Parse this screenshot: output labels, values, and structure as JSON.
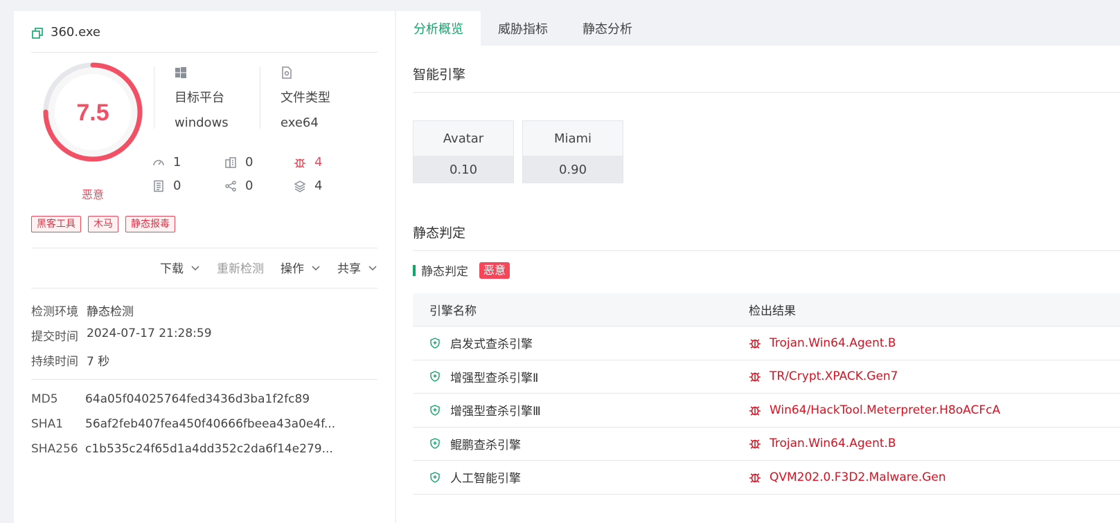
{
  "file": {
    "name": "360.exe"
  },
  "score": {
    "value": "7.5",
    "verdict": "恶意",
    "fraction": 0.75
  },
  "platform": {
    "label": "目标平台",
    "value": "windows"
  },
  "filetype": {
    "label": "文件类型",
    "value": "exe64"
  },
  "stats": [
    {
      "icon": "speedometer-icon",
      "value": "1"
    },
    {
      "icon": "building-icon",
      "value": "0"
    },
    {
      "icon": "bug-icon",
      "value": "4"
    },
    {
      "icon": "document-list-icon",
      "value": "0"
    },
    {
      "icon": "network-share-icon",
      "value": "0"
    },
    {
      "icon": "layers-icon",
      "value": "4"
    }
  ],
  "tags": [
    "黑客工具",
    "木马",
    "静态报毒"
  ],
  "actions": {
    "download": "下载",
    "recheck": "重新检测",
    "operate": "操作",
    "share": "共享"
  },
  "meta": [
    {
      "k": "检测环境",
      "v": "静态检测"
    },
    {
      "k": "提交时间",
      "v": "2024-07-17 21:28:59"
    },
    {
      "k": "持续时间",
      "v": "7 秒"
    }
  ],
  "hashes": [
    {
      "k": "MD5",
      "v": "64a05f04025764fed3436d3ba1f2fc89"
    },
    {
      "k": "SHA1",
      "v": "56af2feb407fea450f40666fbeea43a0e4f..."
    },
    {
      "k": "SHA256",
      "v": "c1b535c24f65d1a4dd352c2da6f14e279..."
    }
  ],
  "tabs": [
    "分析概览",
    "威胁指标",
    "静态分析"
  ],
  "smart_engine": {
    "title": "智能引擎",
    "engines": [
      {
        "name": "Avatar",
        "score": "0.10"
      },
      {
        "name": "Miami",
        "score": "0.90"
      }
    ]
  },
  "static_verdict": {
    "title": "静态判定",
    "sub_label": "静态判定",
    "badge": "恶意",
    "col_engine": "引擎名称",
    "col_result": "检出结果",
    "rows": [
      {
        "engine": "启发式查杀引擎",
        "result": "Trojan.Win64.Agent.B"
      },
      {
        "engine": "增强型查杀引擎Ⅱ",
        "result": "TR/Crypt.XPACK.Gen7"
      },
      {
        "engine": "增强型查杀引擎Ⅲ",
        "result": "Win64/HackTool.Meterpreter.H8oACFcA"
      },
      {
        "engine": "鲲鹏查杀引擎",
        "result": "Trojan.Win64.Agent.B"
      },
      {
        "engine": "人工智能引擎",
        "result": "QVM202.0.F3D2.Malware.Gen"
      }
    ]
  },
  "colors": {
    "accent": "#12a56a",
    "danger": "#e9495a"
  }
}
